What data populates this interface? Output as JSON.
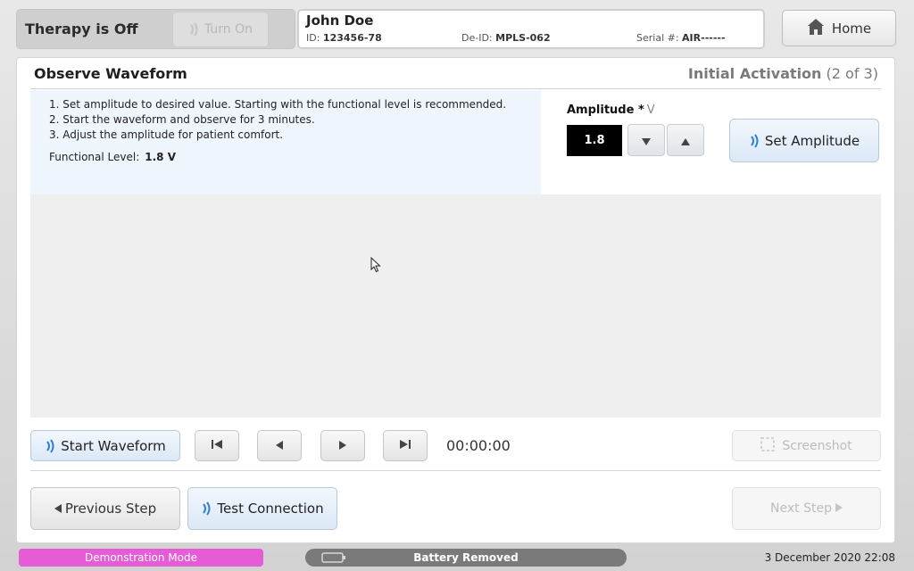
{
  "header": {
    "therapy_status": "Therapy is Off",
    "turn_on_label": "Turn On",
    "patient": {
      "name": "John Doe",
      "id_label": "ID:",
      "id_value": "123456-78",
      "deid_label": "De-ID:",
      "deid_value": "MPLS-062",
      "serial_label": "Serial #:",
      "serial_value": "AIR------"
    },
    "home_label": "Home"
  },
  "main": {
    "title": "Observe Waveform",
    "step_name": "Initial Activation",
    "step_current": "2",
    "step_of": "of",
    "step_total": "3",
    "instructions": [
      "1. Set amplitude to desired value. Starting with the functional level is recommended.",
      "2. Start the waveform and observe for 3 minutes.",
      "3. Adjust the amplitude for patient comfort."
    ],
    "functional_level_label": "Functional Level:",
    "functional_level_value": "1.8 V",
    "amplitude_label": "Amplitude *",
    "amplitude_unit": "V",
    "amplitude_value": "1.8",
    "set_amplitude_label": "Set Amplitude"
  },
  "controls": {
    "start_waveform_label": "Start Waveform",
    "timer": "00:00:00",
    "screenshot_label": "Screenshot",
    "previous_label": "Previous Step",
    "test_connection_label": "Test Connection",
    "next_label": "Next Step"
  },
  "statusbar": {
    "mode": "Demonstration Mode",
    "battery": "Battery Removed",
    "datetime": "3 December 2020 22:08"
  },
  "colors": {
    "demo_badge": "#e65bd6",
    "battery_badge": "#7a7a7a",
    "instructions_bg": "#eef5fd",
    "waveform_bg": "#efefef",
    "accent_blue": "#2d7fd3"
  }
}
